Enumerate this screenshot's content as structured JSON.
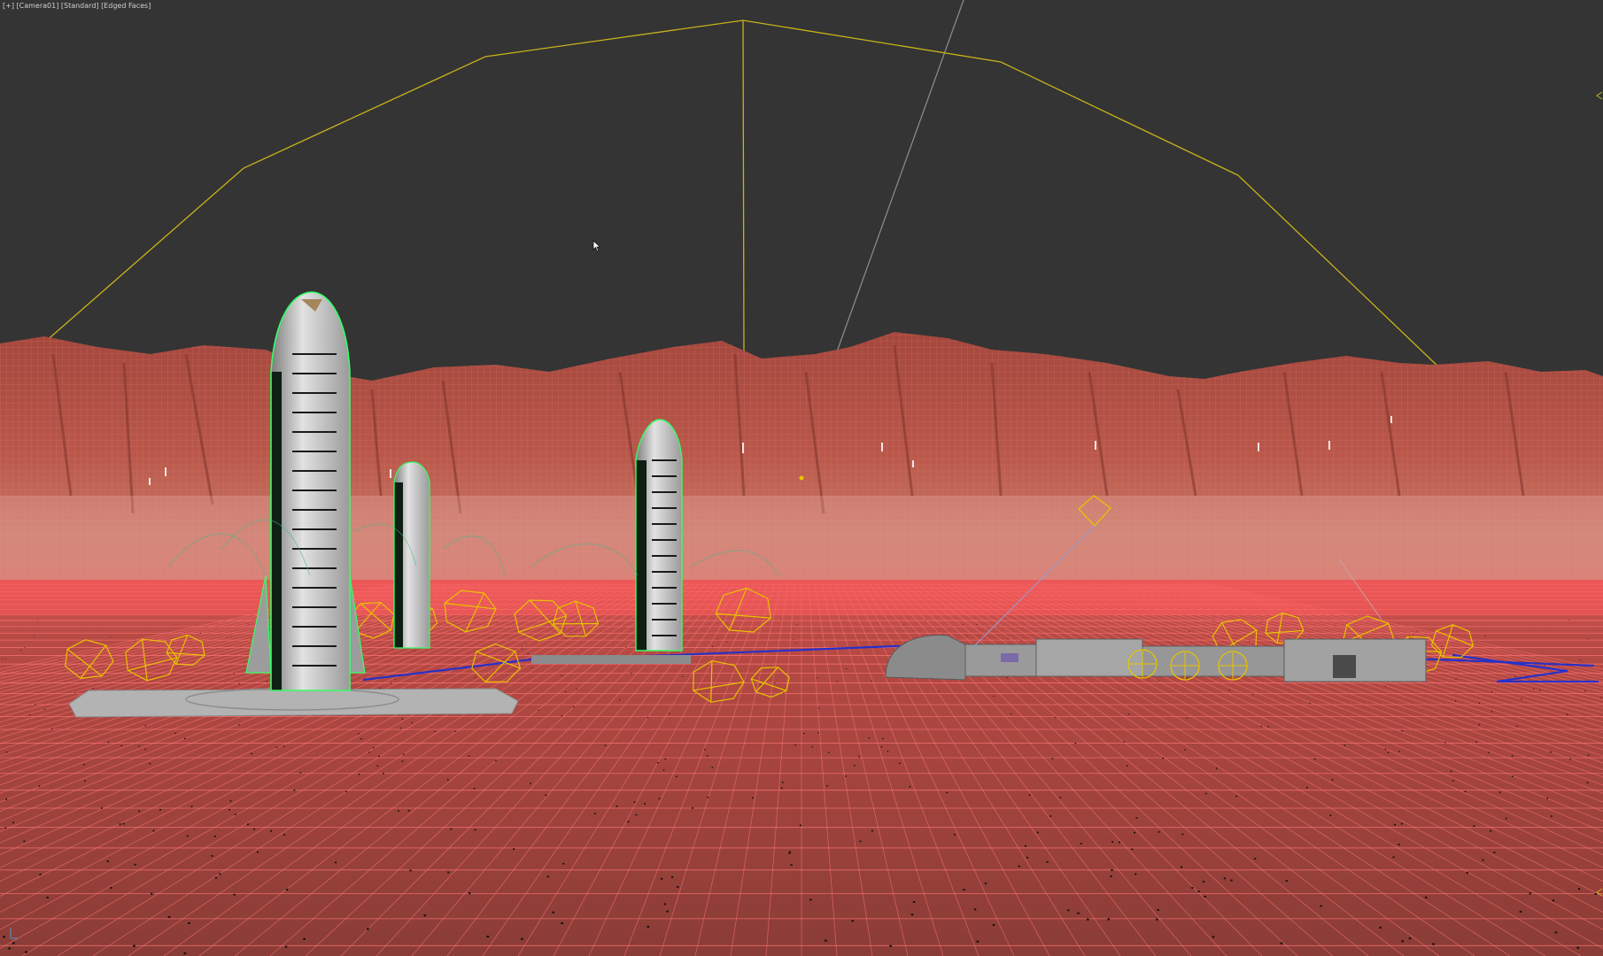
{
  "viewport": {
    "label_segments": [
      "[+]",
      "[Camera01]",
      "[Standard]",
      "[Edged Faces]"
    ],
    "point_of_view": "Camera01",
    "shading": "Standard",
    "display_mode": "Edged Faces",
    "background_color": "#343434"
  },
  "scene": {
    "terrain_color": "#d9554f",
    "ground_grid_color": "#ff6d6d",
    "mountain_color": "#b8564a",
    "selection_color": "#33ff66",
    "gizmo_color": "#e6c000",
    "light_target_color": "#9a9a9a",
    "spline_color": "#2233cc",
    "mesh_color": "#c8c8c8",
    "objects": [
      {
        "kind": "rocket",
        "name": "rocket-large-left",
        "selected": true
      },
      {
        "kind": "rocket",
        "name": "rocket-small-middle",
        "selected": true
      },
      {
        "kind": "rocket",
        "name": "rocket-medium-right",
        "selected": true
      },
      {
        "kind": "launch-pad",
        "name": "launch-pad"
      },
      {
        "kind": "habitat",
        "name": "mars-base-habitat"
      },
      {
        "kind": "camera-target",
        "name": "camera-frustum"
      }
    ]
  },
  "icons": [
    "cursor-arrow-icon",
    "viewport-edge-marker-icon",
    "axis-tripod-icon"
  ]
}
